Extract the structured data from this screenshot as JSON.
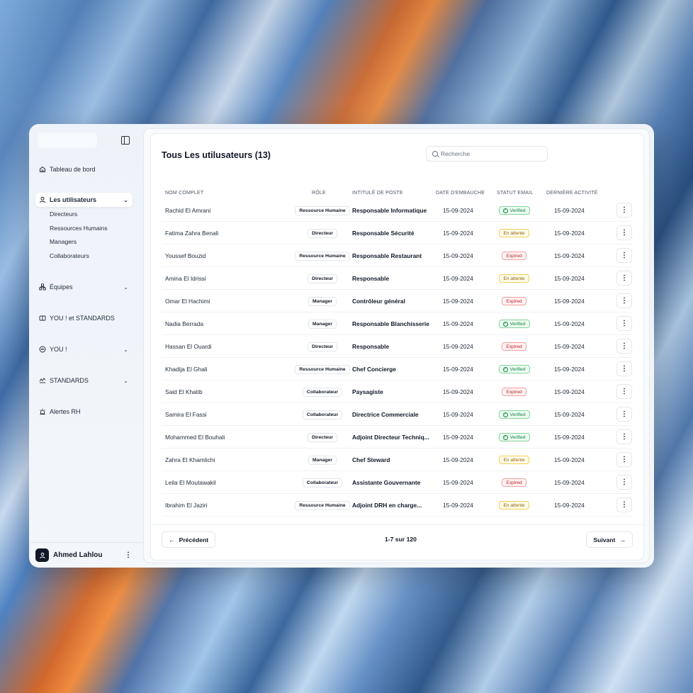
{
  "sidebar": {
    "items": [
      {
        "label": "Tableau de bord",
        "icon": "home-icon",
        "top": 0
      },
      {
        "label": "Les utilisateurs",
        "icon": "user-icon"
      },
      {
        "label": "Équipes",
        "icon": "team-icon"
      },
      {
        "label": "YOU ! et STANDARDS",
        "icon": "book-icon"
      },
      {
        "label": "YOU !",
        "icon": "smile-icon"
      },
      {
        "label": "STANDARDS",
        "icon": "standards-icon"
      },
      {
        "label": "Alertes RH",
        "icon": "siren-icon"
      }
    ],
    "sub_items": [
      "Directeurs",
      "Ressources Humains",
      "Managers",
      "Collaborateurs"
    ],
    "user": {
      "name": "Ahmed Lahlou"
    }
  },
  "main": {
    "title": "Tous Les utilusateurs (13)",
    "search_placeholder": "Recherche",
    "columns": [
      "NOM COMPLET",
      "RÔLE",
      "INTITULÉ DE POSTE",
      "DATE D'EMBAUCHE",
      "STATUT EMAIL",
      "DERNIÈRE ACTIVITÉ"
    ],
    "rows": [
      {
        "name": "Rachid El Amrani",
        "role": "Ressource Humaine",
        "title": "Responsable Informatique",
        "hire": "15-09-2024",
        "status": "Verified",
        "activity": "15-09-2024"
      },
      {
        "name": "Fatima Zahra Benali",
        "role": "Directeur",
        "title": "Responsable Sécurité",
        "hire": "15-09-2024",
        "status": "En attente",
        "activity": "15-09-2024"
      },
      {
        "name": "Youssef Bouzid",
        "role": "Ressource Humaine",
        "title": "Responsable Restaurant",
        "hire": "15-09-2024",
        "status": "Expired",
        "activity": "15-09-2024"
      },
      {
        "name": "Amina El Idrissi",
        "role": "Directeur",
        "title": "Responsable",
        "hire": "15-09-2024",
        "status": "En attente",
        "activity": "15-09-2024"
      },
      {
        "name": "Omar El Hachimi",
        "role": "Manager",
        "title": "Contrôleur général",
        "hire": "15-09-2024",
        "status": "Expired",
        "activity": "15-09-2024"
      },
      {
        "name": "Nadia Berrada",
        "role": "Manager",
        "title": "Responsable Blanchisserie",
        "hire": "15-09-2024",
        "status": "Verified",
        "activity": "15-09-2024"
      },
      {
        "name": "Hassan El Ouardi",
        "role": "Directeur",
        "title": "Responsable",
        "hire": "15-09-2024",
        "status": "Expired",
        "activity": "15-09-2024"
      },
      {
        "name": "Khadija El Ghali",
        "role": "Ressource Humaine",
        "title": "Chef Concierge",
        "hire": "15-09-2024",
        "status": "Verified",
        "activity": "15-09-2024"
      },
      {
        "name": "Said El Khatib",
        "role": "Collaborateur",
        "title": "Paysagiste",
        "hire": "15-09-2024",
        "status": "Expired",
        "activity": "15-09-2024"
      },
      {
        "name": "Samira El Fassi",
        "role": "Collaborateur",
        "title": "Directrice Commerciale",
        "hire": "15-09-2024",
        "status": "Verified",
        "activity": "15-09-2024"
      },
      {
        "name": "Mohammed El Bouhali",
        "role": "Directeur",
        "title": "Adjoint Directeur Techniq...",
        "hire": "15-09-2024",
        "status": "Verified",
        "activity": "15-09-2024"
      },
      {
        "name": "Zahra El Khamlichi",
        "role": "Manager",
        "title": "Chef Steward",
        "hire": "15-09-2024",
        "status": "En attente",
        "activity": "15-09-2024"
      },
      {
        "name": "Leila El Moutawakil",
        "role": "Collaborateur",
        "title": "Assistante Gouvernante",
        "hire": "15-09-2024",
        "status": "Expired",
        "activity": "15-09-2024"
      },
      {
        "name": "Ibrahim El Jaziri",
        "role": "Ressource Humaine",
        "title": "Adjoint DRH en charge...",
        "hire": "15-09-2024",
        "status": "En attente",
        "activity": "15-09-2024"
      }
    ],
    "pagination": {
      "prev": "Précédent",
      "next": "Suivant",
      "info": "1-7 sur 120"
    }
  }
}
